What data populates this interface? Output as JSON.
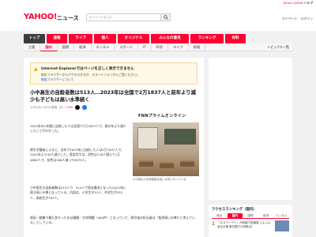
{
  "topbar": {
    "links": "Yahoo! JAPAN",
    "help": "ヘルプ"
  },
  "header": {
    "logo": "YAHOO!",
    "logo_sub": "ニュース",
    "search_placeholder": "キーワードを入力",
    "right_items": [
      "マイページ",
      "ログイン"
    ]
  },
  "nav": {
    "tabs": [
      "トップ",
      "速報",
      "ライブ",
      "個人",
      "オリジナル",
      "みんなの意見",
      "ランキング",
      "有料"
    ],
    "active_index": 0
  },
  "subnav": {
    "items": [
      "主要",
      "国内",
      "国際",
      "経済",
      "エンタメ",
      "スポーツ",
      "IT",
      "科学",
      "ライフ",
      "地域"
    ],
    "selected_index": 1,
    "topics": "トピックス一覧"
  },
  "notice": {
    "title": "Internet Explorerではページを正しく表示できません",
    "line2": "他のブラウザーからアクセスするか、スマートフォンからご覧ください。",
    "link": "推奨ブラウザーについて"
  },
  "article": {
    "title": "小中高生の自殺者数は513人…2023年は全国で2万1837人と前年より減少も子どもは高い水準続く",
    "date": "1/29(月) 19:00 配信",
    "comments": "1769",
    "source": "FNNプライムオンライン",
    "paragraphs": [
      "2023年の1年間に自殺した人は全国で2万1837人で、前の年より減少したことがわかった。",
      "厚生労働省によると、去年で2023年に自殺した人は2万1837人で、2022年より44人減少した。男女別では、男性は116人増えて1万4862人で、女性は160人減って6975人。",
      "小中高生の自殺者数は513人で、514人で過去最多となった2022年に続き高い水準となっている。内訳は、小学生が13人、中学生が153人、高校生が347人。",
      "原因・動機で最も多かったのは健康・生命問題（484件）となっていて、厚労省の担当者は「依然高い水準だと考えている」としている。"
    ],
    "photo_caption": "小中高生の自殺者数は高い水準となっている"
  },
  "ranking": {
    "head": "アクセスランキング（国内）",
    "tabs": [
      "総合",
      "国内",
      "国際",
      "経済",
      "エンタメ"
    ],
    "active_index": 1,
    "first": "1",
    "first_title": "「ヌスワーワー」が前面で危機感 いよいよ迫る大雪 数日間での判断は？"
  },
  "colors": {
    "accent": "#ff0033",
    "nav_active": "#3c3c3c"
  }
}
